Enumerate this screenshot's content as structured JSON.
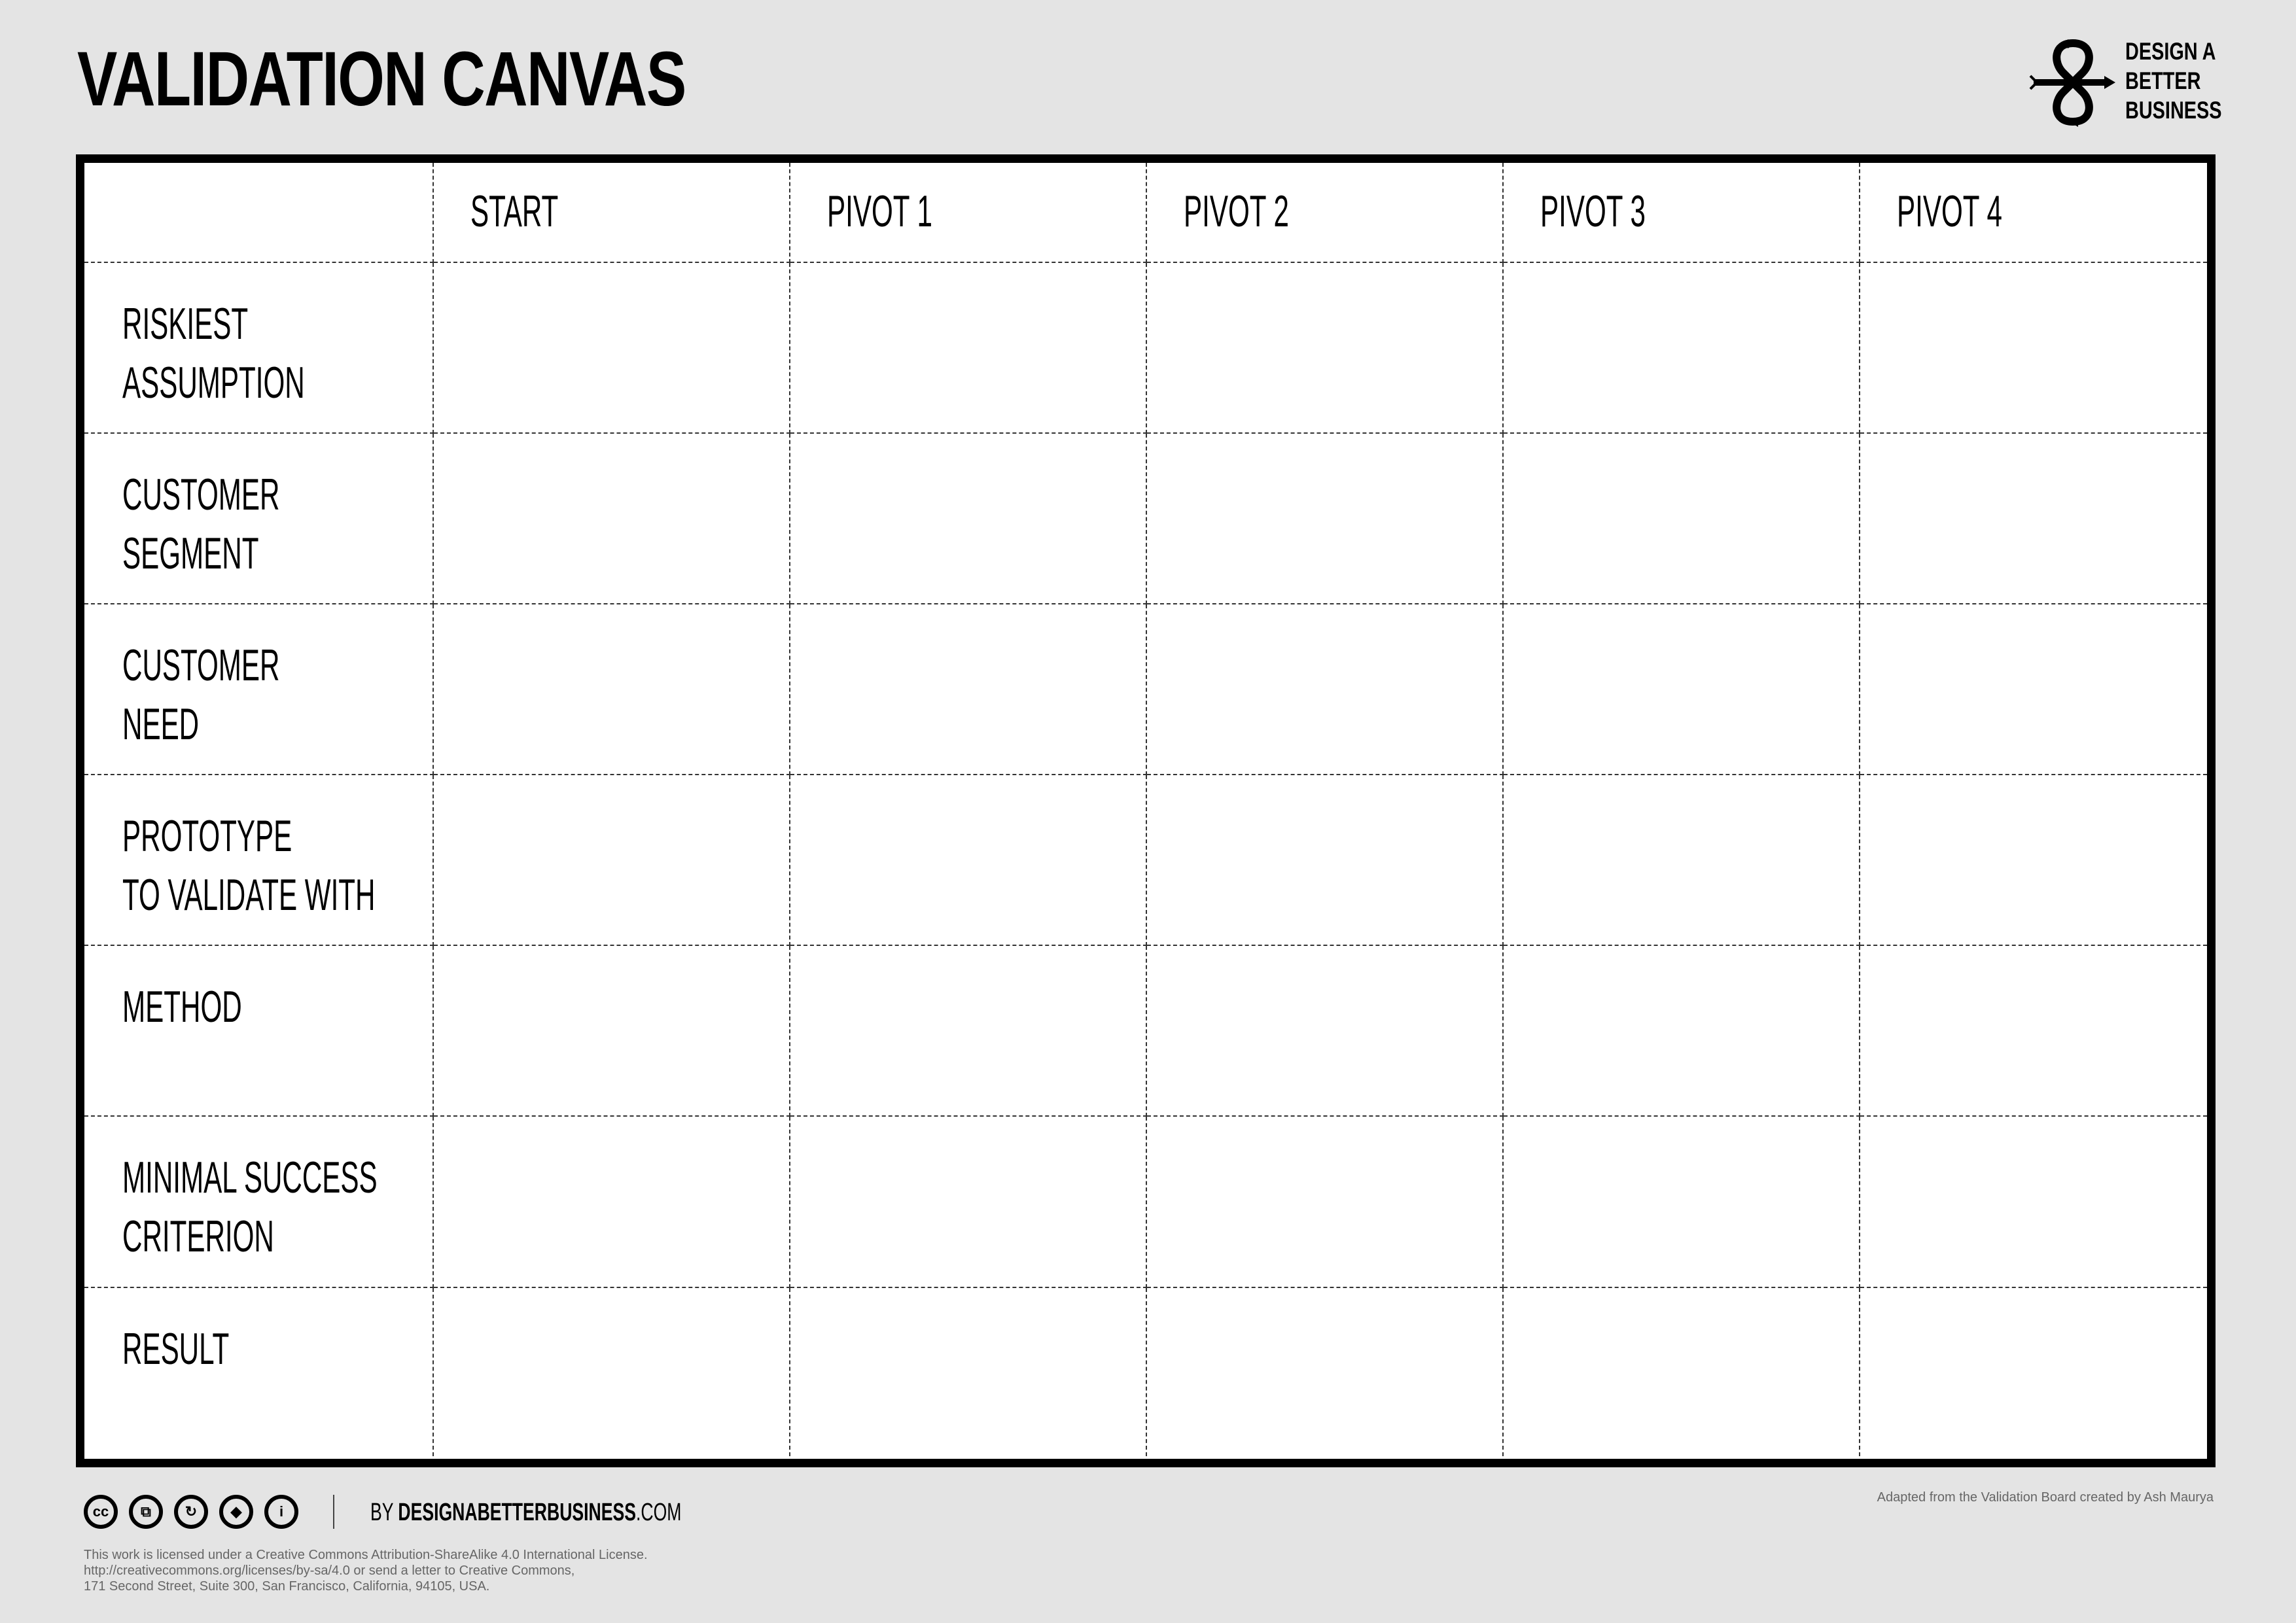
{
  "header": {
    "title": "VALIDATION CANVAS",
    "logo": {
      "icon": "infinity-arrows-logo-icon",
      "lines": [
        "DESIGN A",
        "BETTER",
        "BUSINESS"
      ]
    }
  },
  "canvas": {
    "columns": [
      "",
      "START",
      "PIVOT 1",
      "PIVOT 2",
      "PIVOT 3",
      "PIVOT 4"
    ],
    "rows": [
      {
        "label_lines": [
          "RISKIEST",
          "ASSUMPTION"
        ]
      },
      {
        "label_lines": [
          "CUSTOMER",
          "SEGMENT"
        ]
      },
      {
        "label_lines": [
          "CUSTOMER",
          "NEED"
        ]
      },
      {
        "label_lines": [
          "PROTOTYPE",
          "TO VALIDATE WITH"
        ]
      },
      {
        "label_lines": [
          "METHOD"
        ]
      },
      {
        "label_lines": [
          "MINIMAL SUCCESS",
          "CRITERION"
        ]
      },
      {
        "label_lines": [
          "RESULT"
        ]
      }
    ]
  },
  "footer": {
    "cc_icons": [
      {
        "name": "cc-icon",
        "glyph": "cc"
      },
      {
        "name": "by-icon",
        "glyph": "⧉"
      },
      {
        "name": "share-alike-icon",
        "glyph": "↻"
      },
      {
        "name": "noncommercial-icon",
        "glyph": "◆"
      },
      {
        "name": "attribution-person-icon",
        "glyph": "i"
      }
    ],
    "byline_prefix": "BY ",
    "byline_bold": "DESIGNABETTERBUSINESS",
    "byline_suffix": ".COM",
    "license_lines": [
      "This work is licensed under a Creative Commons Attribution-ShareAlike 4.0 International License.",
      "http://creativecommons.org/licenses/by-sa/4.0 or send a letter to Creative Commons,",
      "171 Second Street, Suite 300, San Francisco, California, 94105, USA."
    ],
    "adapted": "Adapted from the Validation Board created by Ash Maurya"
  }
}
